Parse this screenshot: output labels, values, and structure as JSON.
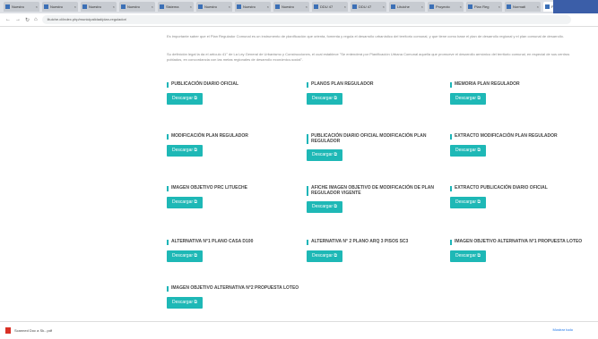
{
  "browser": {
    "tabs": [
      {
        "label": "Nuestro"
      },
      {
        "label": "Nuestro"
      },
      {
        "label": "Nuestro"
      },
      {
        "label": "Nuestro"
      },
      {
        "label": "Sistema"
      },
      {
        "label": "Nuestro"
      },
      {
        "label": "Nuestro"
      },
      {
        "label": "Nuestro"
      },
      {
        "label": "DDU 47"
      },
      {
        "label": "DDU 47"
      },
      {
        "label": "Lituiche"
      },
      {
        "label": "Proyecto"
      },
      {
        "label": "Plan Reg"
      },
      {
        "label": "Normati"
      },
      {
        "label": "Plan Reg"
      }
    ],
    "url": "lituiche.cl/index.php/municipalidad/plan-regulador/"
  },
  "intro": {
    "para1": "Es importante saber que el Plan Regulador Comunal es un instrumento de planificación que orienta, fomenta y regula el desarrollo urbanístico del territorio comunal, y que tiene como base el plan de desarrollo regional y el plan comunal de desarrollo.",
    "para2": "Su definición legal la da el artículo 41° de La Ley General de Urbanismo y Construcciones, el cual establece \"Se entenderá por Planificación Urbana Comunal aquella que promueve el desarrollo armónico del territorio comunal, en especial de sus centros poblados, en concordancia con las metas regionales de desarrollo económico-social\"."
  },
  "button_label": "Descargar",
  "documents": [
    {
      "title": "PUBLICACIÓN DIARIO OFICIAL"
    },
    {
      "title": "PLANOS PLAN REGULADOR"
    },
    {
      "title": "MEMORIA PLAN REGULADOR"
    },
    {
      "title": "MODIFICACIÓN PLAN REGULADOR"
    },
    {
      "title": "PUBLICACIÓN DIARIO OFICIAL MODIFICACIÓN PLAN REGULADOR"
    },
    {
      "title": "EXTRACTO MODIFICACIÓN PLAN REGULADOR"
    },
    {
      "title": "IMAGEN OBJETIVO PRC LITUECHE"
    },
    {
      "title": "AFICHE IMAGEN OBJETIVO DE MODIFICACIÓN DE PLAN REGULADOR VIGENTE"
    },
    {
      "title": "EXTRACTO PUBLICACIÓN DIARIO OFICIAL"
    },
    {
      "title": "ALTERNATIVA N°1 PLANO CASA D100"
    },
    {
      "title": "ALTERNATIVA N° 2 PLANO ARQ 3 PISOS SC3"
    },
    {
      "title": "IMAGEN OBJETIVO ALTERNATIVA N°1 PROPUESTA LOTEO"
    },
    {
      "title": "IMAGEN OBJETIVO ALTERNATIVA N°2 PROPUESTA LOTEO"
    }
  ],
  "downloads_bar": {
    "file": "Scanned Doc a Sk...pdf",
    "show_all": "Mostrar todo"
  },
  "colors": {
    "accent": "#1eb8b6",
    "accent_border": "#1db5b8"
  }
}
